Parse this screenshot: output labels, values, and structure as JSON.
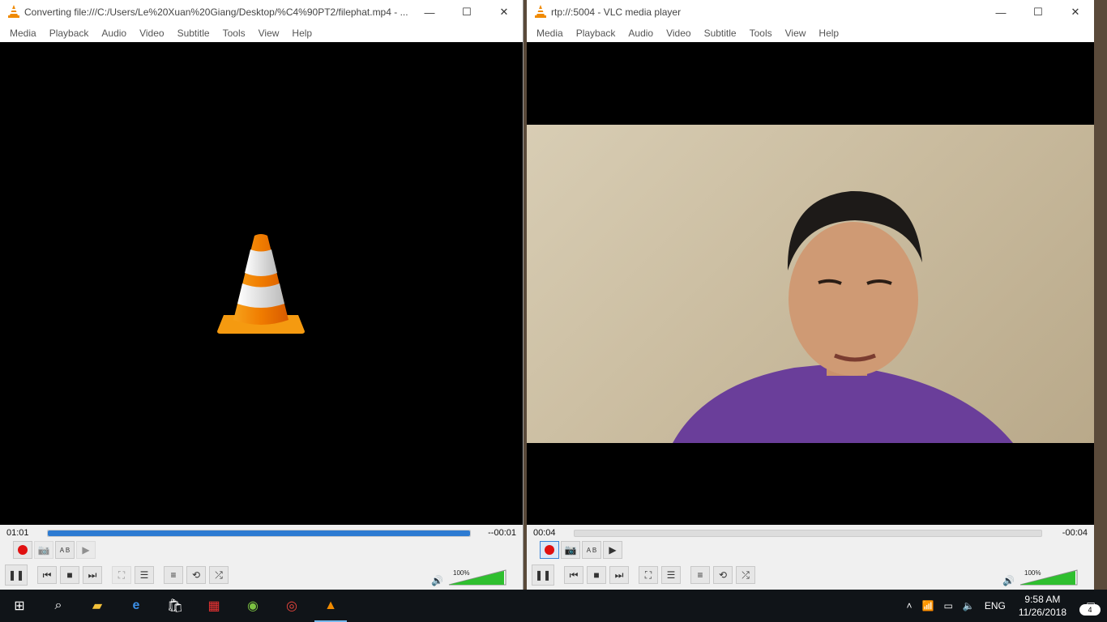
{
  "left_window": {
    "title": "Converting file:///C:/Users/Le%20Xuan%20Giang/Desktop/%C4%90PT2/filephat.mp4 - ...",
    "menu": [
      "Media",
      "Playback",
      "Audio",
      "Video",
      "Subtitle",
      "Tools",
      "View",
      "Help"
    ],
    "time_elapsed": "01:01",
    "time_remaining": "--00:01",
    "progress": 1.0,
    "volume_label": "100%",
    "volume": 1.0
  },
  "right_window": {
    "title": "rtp://:5004 - VLC media player",
    "menu": [
      "Media",
      "Playback",
      "Audio",
      "Video",
      "Subtitle",
      "Tools",
      "View",
      "Help"
    ],
    "time_elapsed": "00:04",
    "time_remaining": "-00:04",
    "progress": 0.0,
    "volume_label": "100%",
    "volume": 1.0
  },
  "taskbar": {
    "language": "ENG",
    "time": "9:58 AM",
    "date": "11/26/2018",
    "notification_count": "4"
  },
  "colors": {
    "accent": "#2d7bd2",
    "record_red": "#e01010",
    "vlc_orange": "#f08a00",
    "volume_green": "#2fbf2f"
  }
}
